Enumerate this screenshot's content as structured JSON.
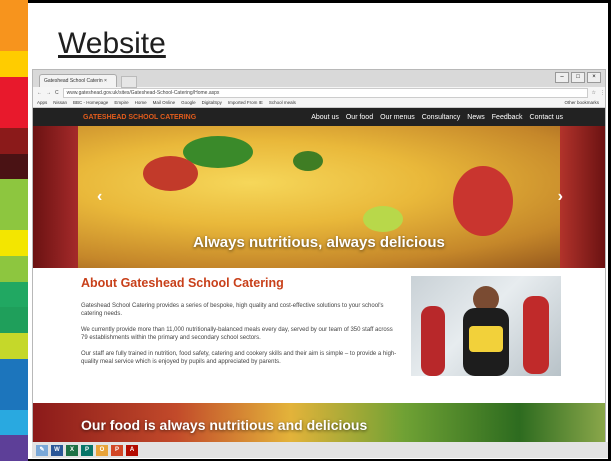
{
  "slide": {
    "title": "Website"
  },
  "stripes": [
    "#f7941d",
    "#f7941d",
    "#ffcc00",
    "#e8192c",
    "#e8192c",
    "#8b1a1a",
    "#4a1214",
    "#8dc63f",
    "#8dc63f",
    "#f3e600",
    "#8dc63f",
    "#21a862",
    "#1f9f5b",
    "#c5d82a",
    "#1c75bc",
    "#1c75bc",
    "#29a9e0",
    "#5d3f98"
  ],
  "browser": {
    "tab_title": "Gateshead School Caterin ×",
    "url": "www.gateshead.gov.uk/sites/Gateshead-School-Catering/Home.aspx",
    "bookmarks": [
      "Apps",
      "Nissan",
      "BBC - Homepage",
      "Empire",
      "Home",
      "Mail Online",
      "Google",
      "DigitalSpy",
      "Imported From IE",
      "School meals"
    ],
    "other_bookmarks": "Other bookmarks"
  },
  "site": {
    "brand": "GATESHEAD SCHOOL CATERING",
    "nav": [
      "About us",
      "Our food",
      "Our menus",
      "Consultancy",
      "News",
      "Feedback",
      "Contact us"
    ],
    "hero_caption": "Always nutritious, always delicious",
    "about_title": "About Gateshead School Catering",
    "about_paragraphs": [
      "Gateshead School Catering provides a series of bespoke, high quality and cost-effective solutions to your school's catering needs.",
      "We currently provide more than 11,000 nutritionally-balanced meals every day, served by our team of 350 staff across 79 establishments within the primary and secondary school sectors.",
      "Our staff are fully trained in nutrition, food safety, catering and cookery skills and their aim is simple – to provide a high-quality meal service which is enjoyed by pupils and appreciated by parents."
    ],
    "band_text": "Our food is always nutritious and delicious"
  },
  "taskbar": [
    "paint-icon",
    "word-icon",
    "excel-icon",
    "publisher-icon",
    "outlook-icon",
    "powerpoint-icon",
    "acrobat-icon"
  ]
}
